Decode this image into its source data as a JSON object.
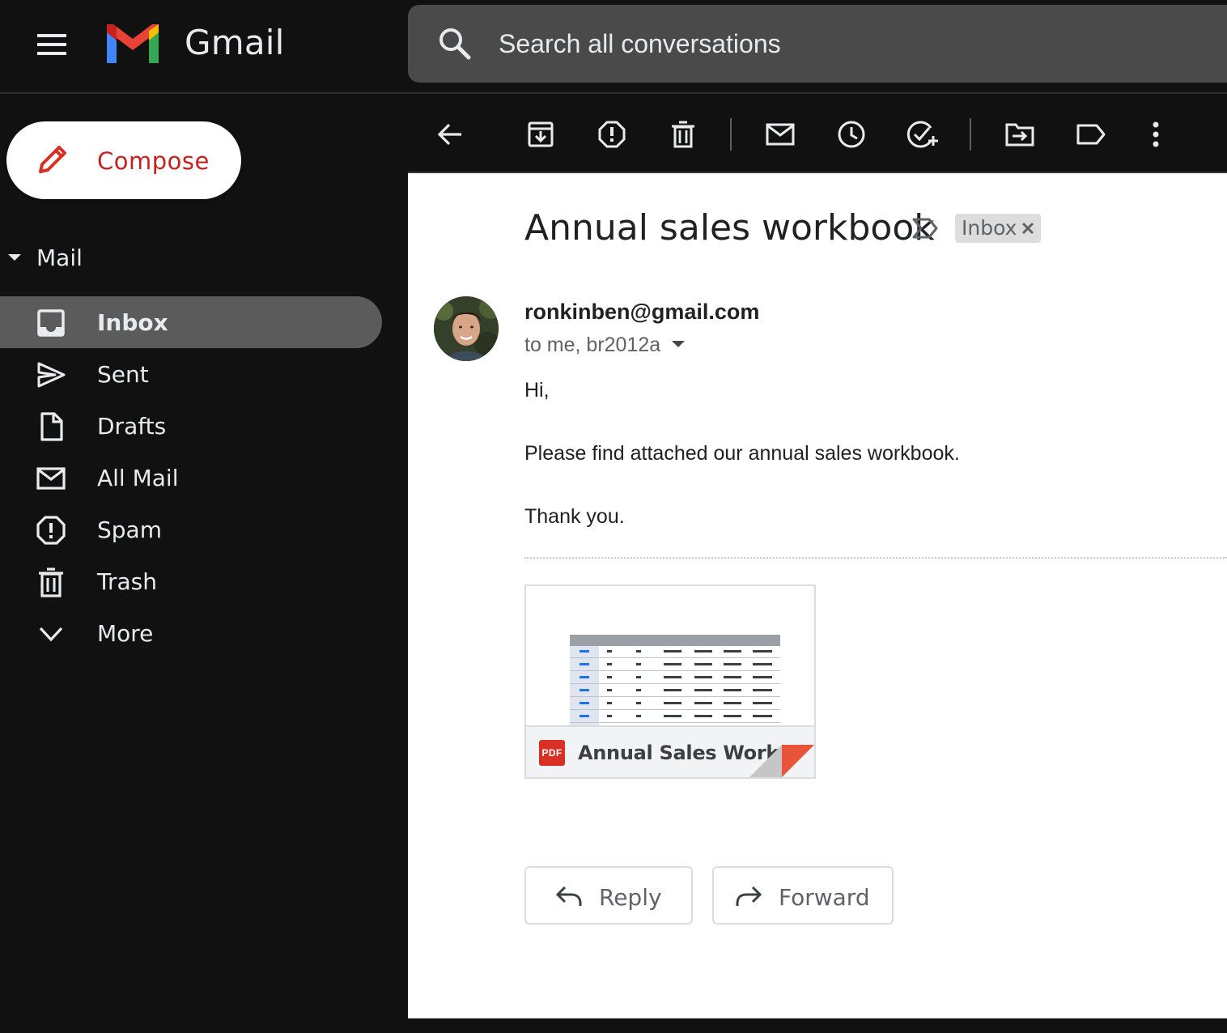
{
  "app": {
    "name": "Gmail"
  },
  "search": {
    "placeholder": "Search all conversations"
  },
  "sidebar": {
    "compose_label": "Compose",
    "section_label": "Mail",
    "items": [
      {
        "label": "Inbox",
        "icon": "inbox-icon",
        "active": true
      },
      {
        "label": "Sent",
        "icon": "send-icon",
        "active": false
      },
      {
        "label": "Drafts",
        "icon": "draft-icon",
        "active": false
      },
      {
        "label": "All Mail",
        "icon": "mail-icon",
        "active": false
      },
      {
        "label": "Spam",
        "icon": "spam-icon",
        "active": false
      },
      {
        "label": "Trash",
        "icon": "trash-icon",
        "active": false
      },
      {
        "label": "More",
        "icon": "chevron-down-icon",
        "active": false
      }
    ]
  },
  "toolbar": {
    "buttons": [
      "back-arrow-icon",
      "archive-icon",
      "report-spam-icon",
      "delete-icon",
      "mark-unread-icon",
      "snooze-icon",
      "add-task-icon",
      "move-to-icon",
      "label-icon",
      "more-vert-icon"
    ]
  },
  "message": {
    "subject": "Annual sales workbook",
    "label_chip": "Inbox",
    "sender": "ronkinben@gmail.com",
    "recipients": "to me, br2012a",
    "body": [
      "Hi,",
      "Please find attached our annual sales workbook.",
      "Thank you."
    ],
    "attachment": {
      "name": "Annual Sales Work...",
      "type_badge": "PDF"
    },
    "actions": {
      "reply": "Reply",
      "forward": "Forward"
    }
  },
  "colors": {
    "background": "#111111",
    "active_nav": "#5b5b5b",
    "search_bg": "#4a4a4a",
    "compose_text": "#c5221f",
    "pdf_red": "#d93025",
    "fold_orange": "#e8533a"
  }
}
